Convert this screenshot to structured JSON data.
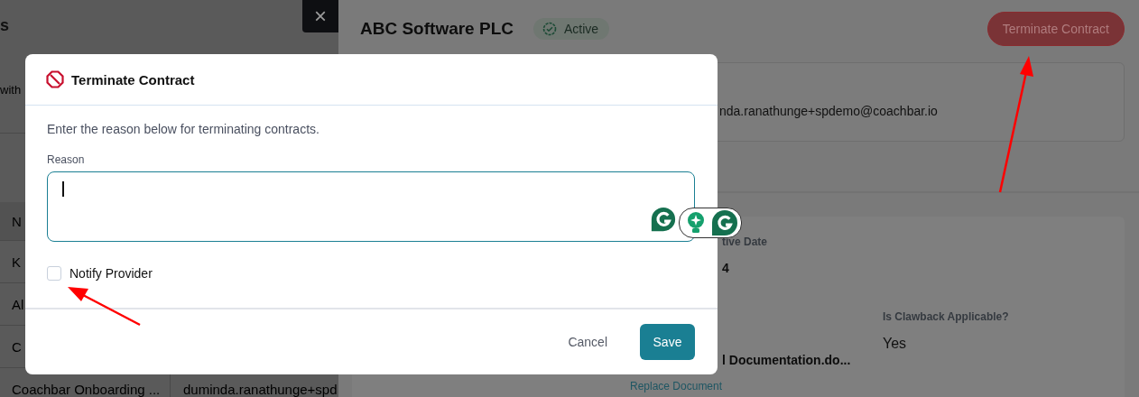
{
  "left_panel": {
    "title_fragment": "s",
    "description_fragment": "with",
    "table": {
      "header": "N",
      "rows": [
        {
          "column_1": "K"
        },
        {
          "column_1": "Al"
        },
        {
          "column_1": "C"
        },
        {
          "column_1": "Coachbar Onboarding ...",
          "column_2": "duminda.ranathunge+spd"
        }
      ]
    }
  },
  "close_button": "×",
  "drawer": {
    "title": "ABC Software PLC",
    "status": "Active",
    "terminate_button": "Terminate Contract",
    "email_fragment": "nda.ranathunge+spdemo@coachbar.io",
    "details": {
      "date_label_fragment": "tive Date",
      "date_value_fragment": "4",
      "document_fragment": "l Documentation.do...",
      "replace_link": "Replace Document",
      "clawback_label": "Is Clawback Applicable?",
      "clawback_value": "Yes"
    }
  },
  "dialog": {
    "title": "Terminate Contract",
    "instructions": "Enter the reason below for terminating contracts.",
    "reason_label": "Reason",
    "notify": {
      "label": "Notify Provider",
      "checked": false
    },
    "cancel_button": "Cancel",
    "save_button": "Save"
  }
}
